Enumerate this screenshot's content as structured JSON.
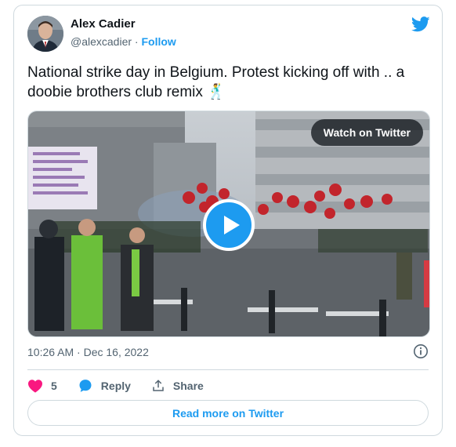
{
  "author": {
    "name": "Alex Cadier",
    "handle": "@alexcadier",
    "separator": "·",
    "follow_label": "Follow"
  },
  "tweet": {
    "text": "National strike day in Belgium. Protest kicking off with .. a doobie brothers club remix 🕺",
    "timestamp": "10:26 AM · Dec 16, 2022"
  },
  "media": {
    "watch_label": "Watch on Twitter"
  },
  "actions": {
    "like_count": "5",
    "reply_label": "Reply",
    "share_label": "Share"
  },
  "footer": {
    "read_more_label": "Read more on Twitter"
  },
  "colors": {
    "accent": "#1d9bf0",
    "like": "#f91880",
    "muted": "#536471",
    "border": "#cfd9de"
  },
  "icons": [
    "twitter-bird-icon",
    "play-icon",
    "info-icon",
    "heart-icon",
    "reply-icon",
    "share-icon"
  ]
}
